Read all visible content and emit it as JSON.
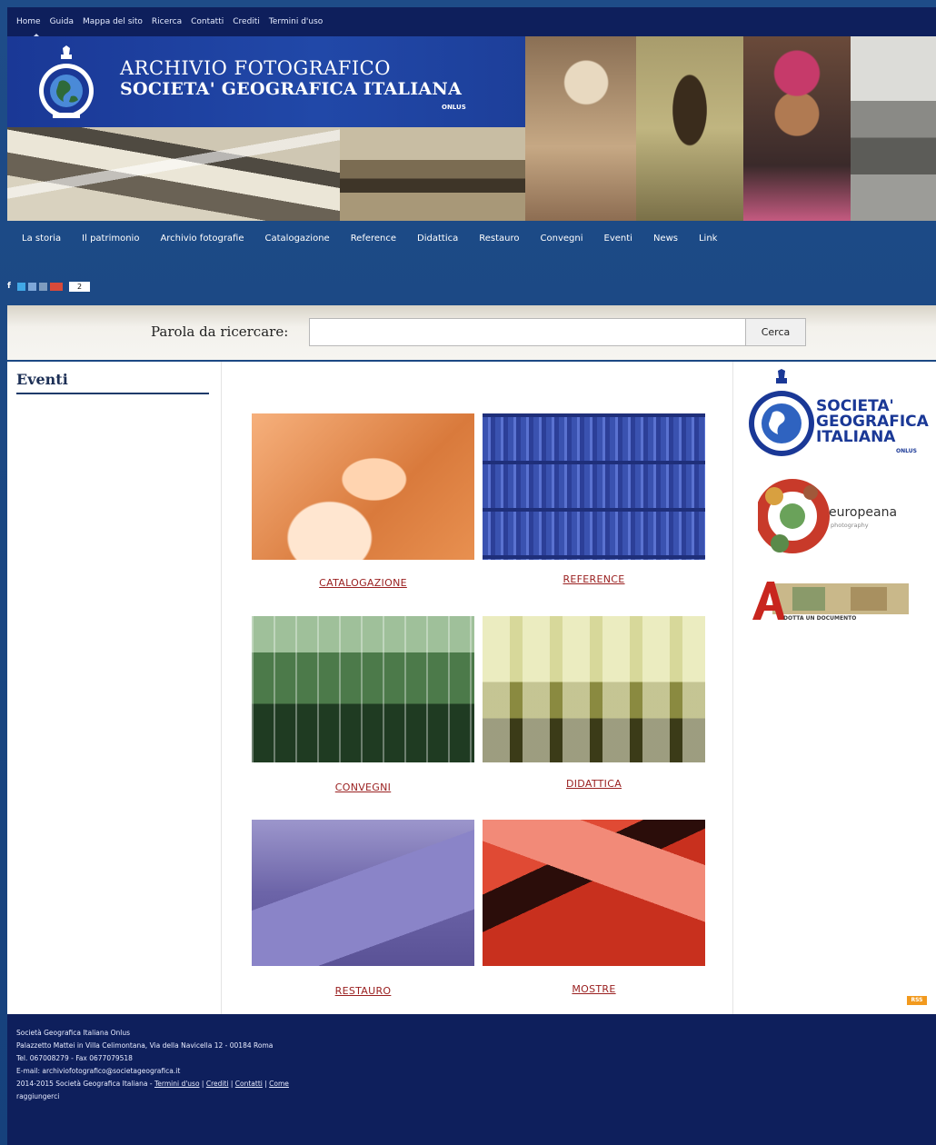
{
  "topnav": {
    "items": [
      "Home",
      "Guida",
      "Mappa del sito",
      "Ricerca",
      "Contatti",
      "Crediti",
      "Termini d'uso"
    ]
  },
  "header": {
    "title_line1": "ARCHIVIO FOTOGRAFICO",
    "title_line2": "SOCIETA' GEOGRAFICA ITALIANA",
    "onlus": "ONLUS"
  },
  "mainnav": {
    "items": [
      "La storia",
      "Il patrimonio",
      "Archivio fotografie",
      "Catalogazione",
      "Reference",
      "Didattica",
      "Restauro",
      "Convegni",
      "Eventi",
      "News",
      "Link"
    ]
  },
  "social": {
    "share_count": "2"
  },
  "search": {
    "label": "Parola da ricercare:",
    "value": "",
    "button": "Cerca"
  },
  "sidebar": {
    "title": "Eventi"
  },
  "tiles": [
    {
      "caption": "CATALOGAZIONE",
      "color": "#e08a4c"
    },
    {
      "caption": "REFERENCE",
      "color": "#3550b0"
    },
    {
      "caption": "CONVEGNI",
      "color": "#4e7a4a"
    },
    {
      "caption": "DIDATTICA",
      "color": "#a0a04a"
    },
    {
      "caption": "RESTAURO",
      "color": "#746cb4"
    },
    {
      "caption": "MOSTRE",
      "color": "#c8301e"
    }
  ],
  "partners": {
    "sgi_line1": "SOCIETA'",
    "sgi_line2": "GEOGRAFICA",
    "sgi_line3": "ITALIANA",
    "sgi_onlus": "ONLUS",
    "europeana": "europeana",
    "europeana_sub": "photography",
    "adotta": "DOTTA UN DOCUMENTO"
  },
  "rss": "RSS",
  "footer": {
    "line1": "Società Geografica Italiana Onlus",
    "line2": "Palazzetto Mattei in Villa Celimontana, Via della Navicella 12 - 00184 Roma",
    "line3": "Tel. 067008279 - Fax 0677079518",
    "line4": "E-mail: archiviofotografico@societageografica.it",
    "line5_prefix": "2014-2015 Società Geografica Italiana - ",
    "links": [
      "Termini d'uso",
      "Crediti",
      "Contatti",
      "Come"
    ],
    "line6": "raggiungerci"
  },
  "colors": {
    "page_bg": "#1d4a86",
    "bar_bg": "#0e1f5c",
    "caption": "#9a2020"
  }
}
